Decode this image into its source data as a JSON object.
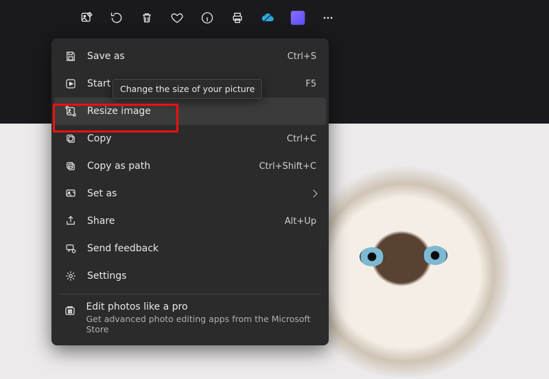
{
  "toolbar": {
    "items": [
      "edit",
      "rotate",
      "delete",
      "favorite",
      "info",
      "print",
      "cloud",
      "clipchamp",
      "more"
    ]
  },
  "tooltip": {
    "text": "Change the size of your picture"
  },
  "menu": {
    "items": [
      {
        "id": "save-as",
        "label": "Save as",
        "accel": "Ctrl+S"
      },
      {
        "id": "start-slide",
        "label": "Start",
        "accel": "F5"
      },
      {
        "id": "resize",
        "label": "Resize image",
        "accel": ""
      },
      {
        "id": "copy",
        "label": "Copy",
        "accel": "Ctrl+C"
      },
      {
        "id": "copy-path",
        "label": "Copy as path",
        "accel": "Ctrl+Shift+C"
      },
      {
        "id": "set-as",
        "label": "Set as",
        "accel": "",
        "submenu": true
      },
      {
        "id": "share",
        "label": "Share",
        "accel": "Alt+Up"
      },
      {
        "id": "feedback",
        "label": "Send feedback",
        "accel": ""
      },
      {
        "id": "settings",
        "label": "Settings",
        "accel": ""
      }
    ],
    "promo": {
      "title": "Edit photos like a pro",
      "subtitle": "Get advanced photo editing apps from the Microsoft Store"
    }
  }
}
